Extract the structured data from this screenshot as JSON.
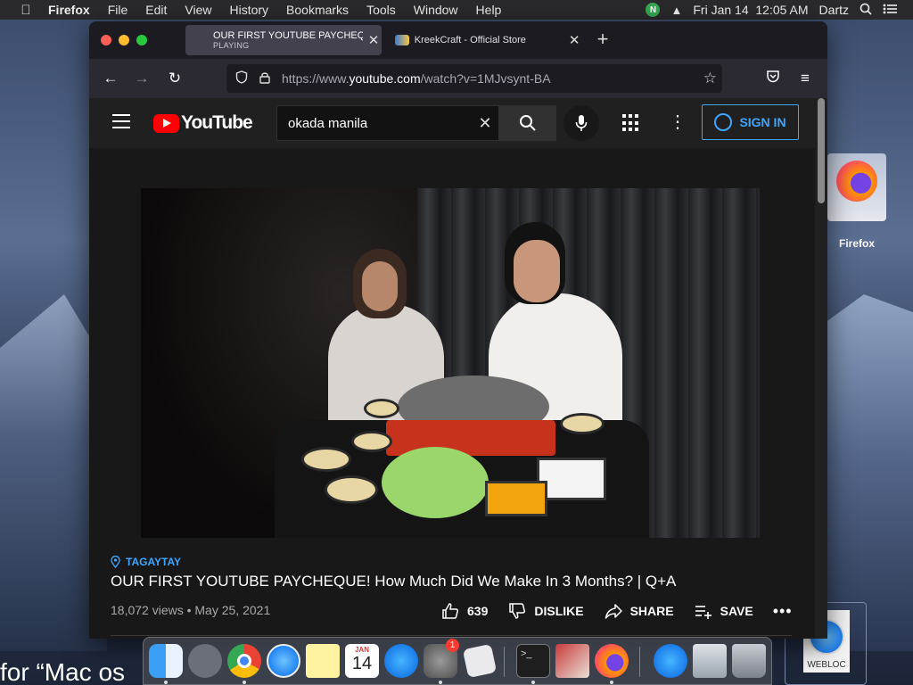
{
  "menubar": {
    "app": "Firefox",
    "items": [
      "File",
      "Edit",
      "View",
      "History",
      "Bookmarks",
      "Tools",
      "Window",
      "Help"
    ],
    "clock": "Fri Jan 14  12:05 AM",
    "user": "Dartz",
    "n_badge": "N"
  },
  "tabs": [
    {
      "title": "OUR FIRST YOUTUBE PAYCHEQ",
      "status": "PLAYING",
      "icon": "youtube-favicon"
    },
    {
      "title": "KreekCraft - Official Store",
      "icon": "kreekcraft-favicon"
    }
  ],
  "url": {
    "prefix": "https://www.",
    "domain": "youtube.com",
    "path": "/watch?v=1MJvsynt-BA"
  },
  "youtube": {
    "logo_text": "YouTube",
    "search_query": "okada manila",
    "sign_in": "SIGN IN",
    "location": "TAGAYTAY",
    "title": "OUR FIRST YOUTUBE PAYCHEQUE! How Much Did We Make In 3 Months? | Q+A",
    "meta": "18,072 views • May 25, 2021",
    "likes": "639",
    "dislike": "DISLIKE",
    "share": "SHARE",
    "save": "SAVE",
    "more": "•••"
  },
  "desktop": {
    "firefox_label": "Firefox",
    "webloc_label": "WEBLOC",
    "partial_text": "for “Mac os"
  },
  "dock": {
    "calendar_month": "JAN",
    "calendar_day": "14",
    "sysprefs_badge": "1"
  },
  "colors": {
    "youtube_red": "#ff0000",
    "link_blue": "#3ea6ff",
    "firefox_tab": "#42414d"
  }
}
